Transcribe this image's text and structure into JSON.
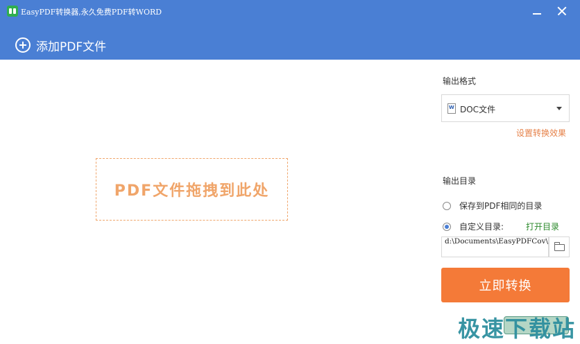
{
  "app": {
    "title": "EasyPDF转换器,永久免费PDF转WORD",
    "logo_icon": "app-logo-icon",
    "accent_color": "#4a7fd4"
  },
  "toolbar": {
    "add_pdf_label": "添加PDF文件",
    "add_pdf_icon": "plus-circle-icon"
  },
  "dropzone": {
    "text": "PDF文件拖拽到此处",
    "color": "#f0a56a"
  },
  "output_format": {
    "label": "输出格式",
    "selected": "DOC文件",
    "settings_link": "设置转换效果"
  },
  "output_dir": {
    "label": "输出目录",
    "options": [
      {
        "label": "保存到PDF相同的目录",
        "checked": false
      },
      {
        "label": "自定义目录:",
        "checked": true
      }
    ],
    "open_link": "打开目录",
    "path_value": "d:\\Documents\\EasyPDFCov\\"
  },
  "actions": {
    "convert_label": "立即转换",
    "convert_color": "#f47a38"
  },
  "watermark": {
    "text": "极速下载站"
  }
}
